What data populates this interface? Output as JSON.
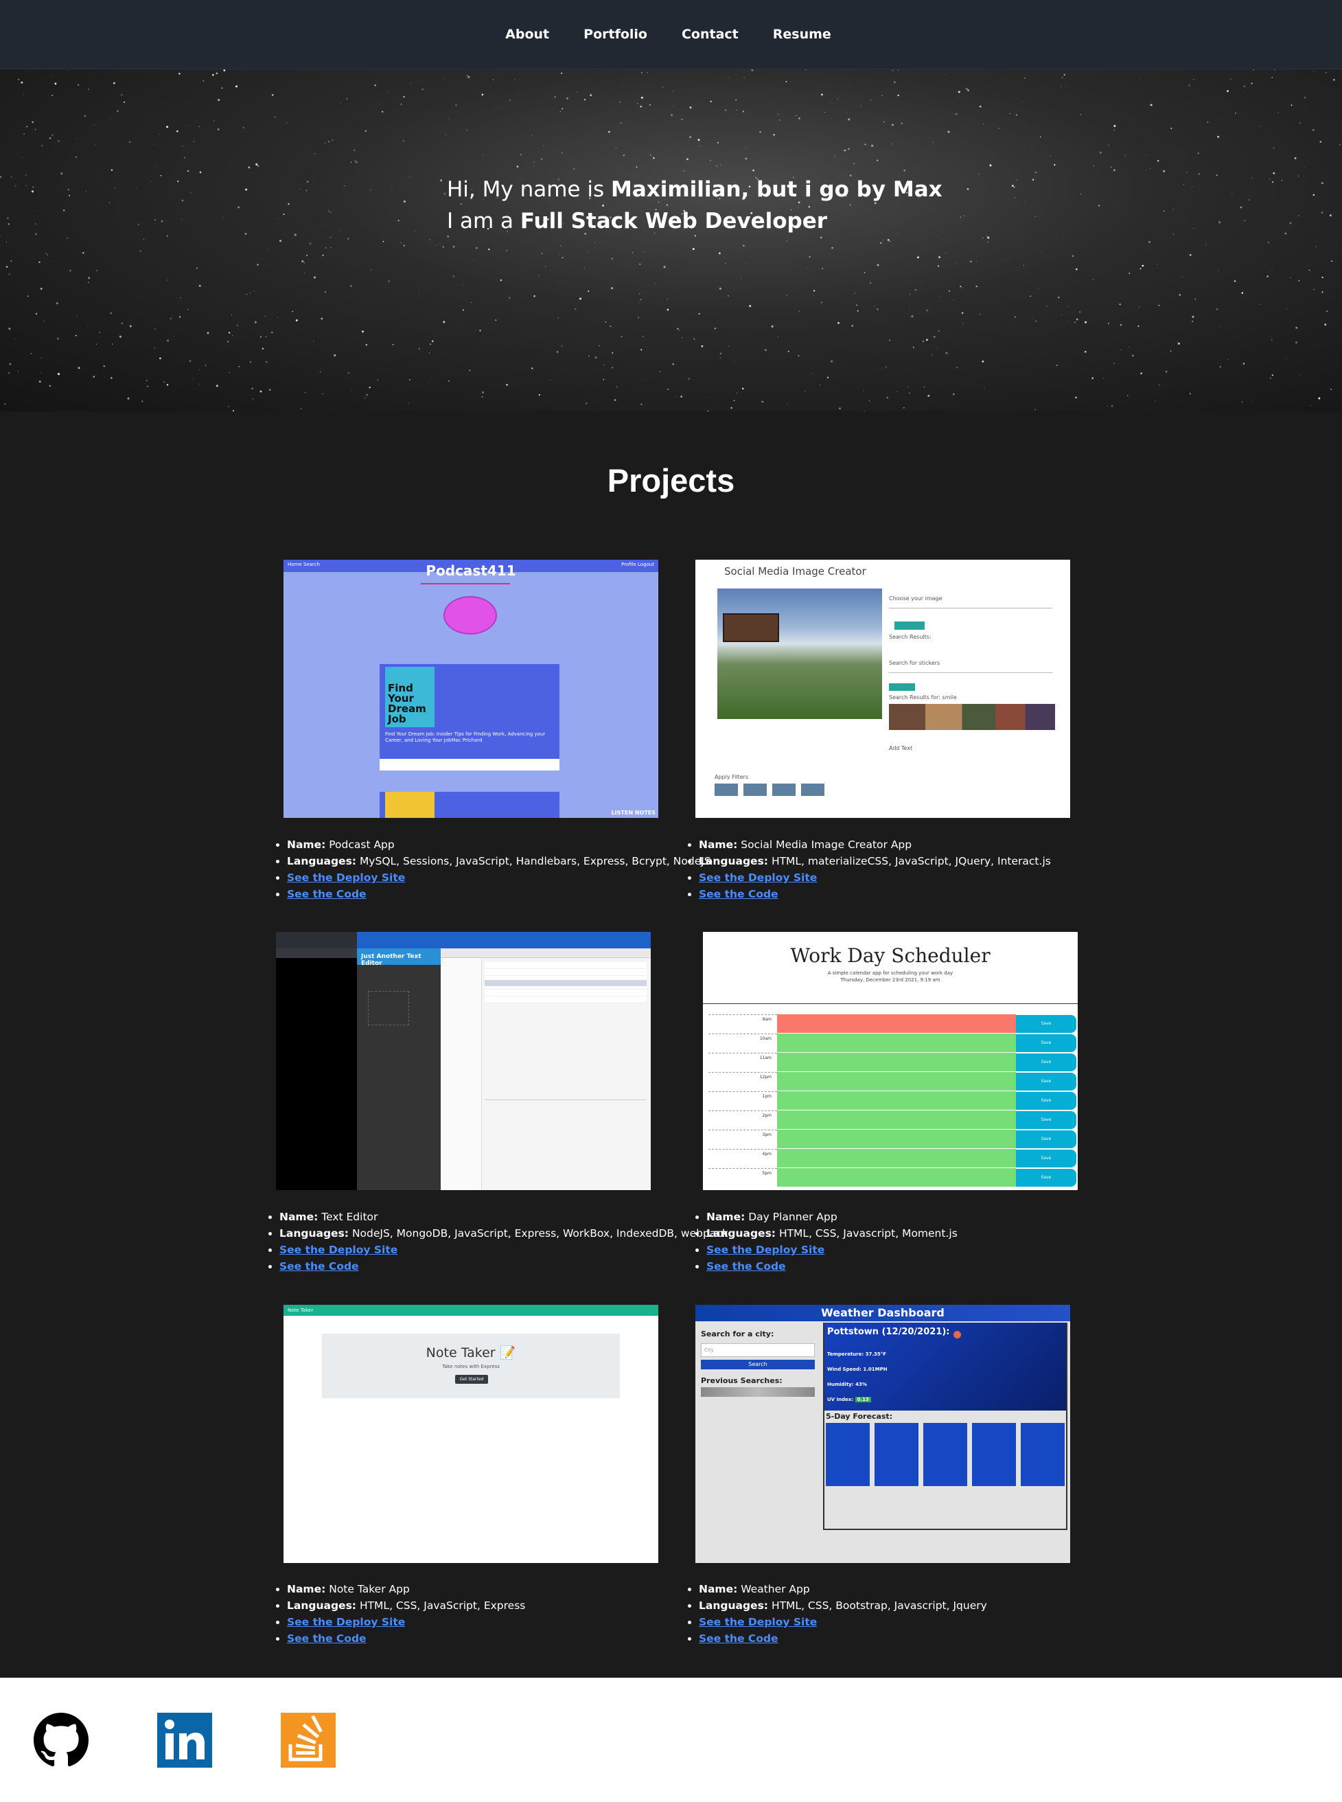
{
  "nav": {
    "links": [
      "About",
      "Portfolio",
      "Contact",
      "Resume"
    ]
  },
  "hero": {
    "line1_prefix": "Hi, My name is ",
    "line1_strong": "Maximilian, but i go by Max",
    "line2_prefix": "I am a ",
    "line2_strong": "Full Stack Web Developer"
  },
  "projects": {
    "title": "Projects",
    "name_label": "Name:",
    "languages_label": "Languages:",
    "deploy_label": "See the Deploy Site",
    "code_label": "See the Code",
    "items": [
      {
        "name": "Podcast App",
        "languages": "MySQL, Sessions, JavaScript, Handlebars, Express, Bcrypt, NodeJS",
        "thumb": {
          "brand": "Podcast411",
          "nav_left": "Home  Search",
          "nav_right": "Profile  Logout",
          "card_title": "Find Your Dream Job",
          "card_desc": "Find Your Dream Job: Insider Tips for Finding Work, Advancing your Career, and Loving Your JobMac Prichard",
          "footer": "LISTEN NOTES"
        }
      },
      {
        "name": "Social Media Image Creator App",
        "languages": "HTML, materializeCSS, JavaScript, JQuery, Interact.js",
        "thumb": {
          "title": "Social Media Image Creator",
          "choose": "Choose your image",
          "search_results": "Search Results:",
          "search_stickers": "Search for stickers",
          "results_for": "Search Results for: smile",
          "add_text": "Add Text",
          "apply_filters": "Apply Filters"
        }
      },
      {
        "name": "Text Editor",
        "languages": "NodeJS, MongoDB, JavaScript, Express, WorkBox, IndexedDB, webpack",
        "thumb": {
          "title": "Just Another Text Editor"
        }
      },
      {
        "name": "Day Planner App",
        "languages": "HTML, CSS, Javascript, Moment.js",
        "thumb": {
          "title": "Work Day Scheduler",
          "subtitle": "A simple calendar app for scheduling your work day",
          "date": "Thursday, December 23rd 2021, 9:19 am",
          "hours": [
            "9am",
            "10am",
            "11am",
            "12pm",
            "1pm",
            "2pm",
            "3pm",
            "4pm",
            "5pm"
          ],
          "save": "Save"
        }
      },
      {
        "name": "Note Taker App",
        "languages": "HTML, CSS, JavaScript, Express",
        "thumb": {
          "bar": "Note Taker",
          "title": "Note Taker 📝",
          "subtitle": "Take notes with Express",
          "button": "Get Started"
        }
      },
      {
        "name": "Weather App",
        "languages": "HTML, CSS, Bootstrap, Javascript, Jquery",
        "thumb": {
          "title": "Weather Dashboard",
          "search_label": "Search for a city:",
          "placeholder": "City",
          "search_btn": "Search",
          "previous": "Previous Searches:",
          "city": "Pottstown (12/20/2021):",
          "temperature": "Temperature: 37.35°F",
          "wind": "Wind Speed: 1.01MPH",
          "humidity": "Humidity: 43%",
          "uv": "UV Index:",
          "uv_value": "0.13",
          "forecast": "5-Day Forecast:"
        }
      }
    ]
  },
  "footer": {
    "icons": [
      "github-icon",
      "linkedin-icon",
      "stackoverflow-icon"
    ]
  },
  "colors": {
    "nav_bg": "#222831",
    "page_bg": "#1b1b1c",
    "link": "#4a8cff",
    "footer_bg": "#ffffff"
  }
}
